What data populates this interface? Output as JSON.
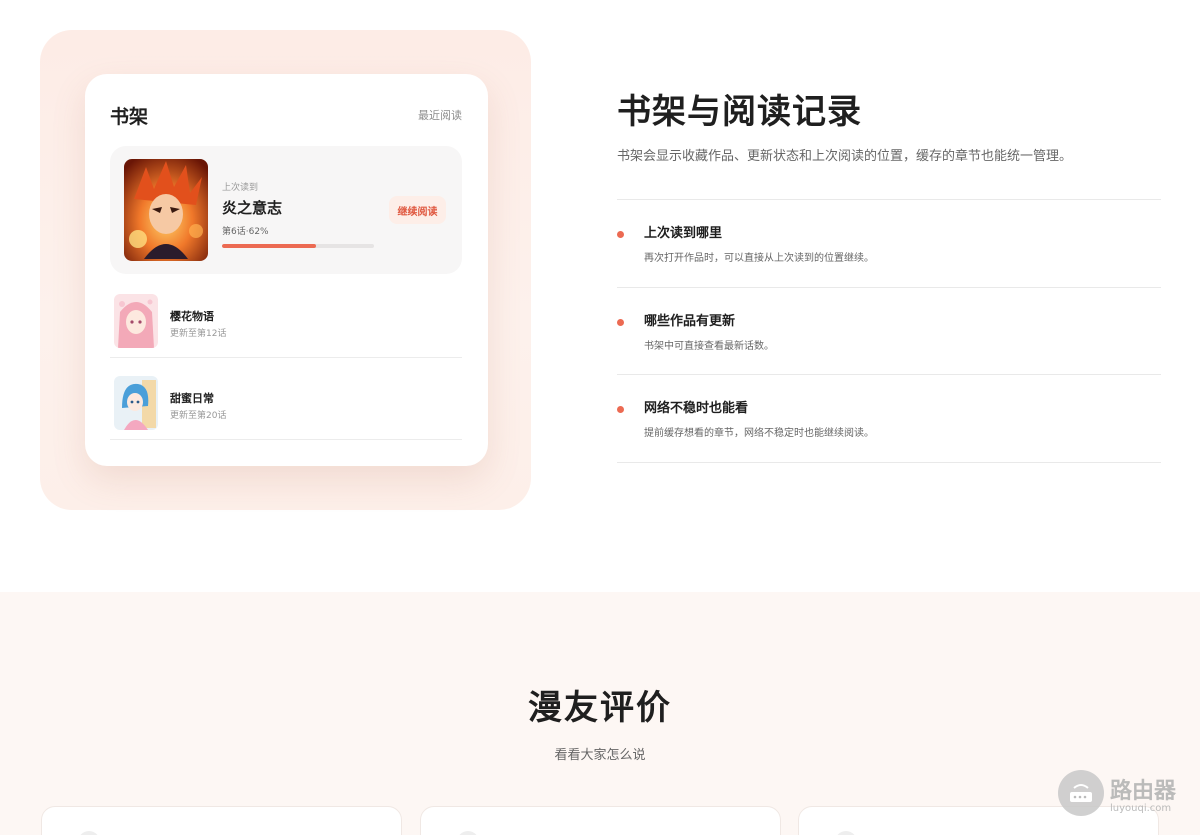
{
  "shelf": {
    "title": "书架",
    "recent_link": "最近阅读",
    "current": {
      "label": "上次读到",
      "title": "炎之意志",
      "progress_text": "第6话·62%",
      "progress": 0.62,
      "button": "继续阅读"
    },
    "items": [
      {
        "title": "樱花物语",
        "subtitle": "更新至第12话"
      },
      {
        "title": "甜蜜日常",
        "subtitle": "更新至第20话"
      }
    ]
  },
  "section": {
    "heading": "书架与阅读记录",
    "description": "书架会显示收藏作品、更新状态和上次阅读的位置，缓存的章节也能统一管理。",
    "features": [
      {
        "title": "上次读到哪里",
        "desc": "再次打开作品时，可以直接从上次读到的位置继续。"
      },
      {
        "title": "哪些作品有更新",
        "desc": "书架中可直接查看最新话数。"
      },
      {
        "title": "网络不稳时也能看",
        "desc": "提前缓存想看的章节，网络不稳定时也能继续阅读。"
      }
    ]
  },
  "reviews": {
    "title": "漫友评价",
    "subtitle": "看看大家怎么说"
  },
  "watermark": {
    "text": "路由器",
    "sub": "luyouqi.com"
  },
  "colors": {
    "accent": "#ec6a52",
    "accent_soft": "#fdeee8",
    "panel_bg": "#fdece6",
    "reviews_bg": "#fdf7f4"
  }
}
